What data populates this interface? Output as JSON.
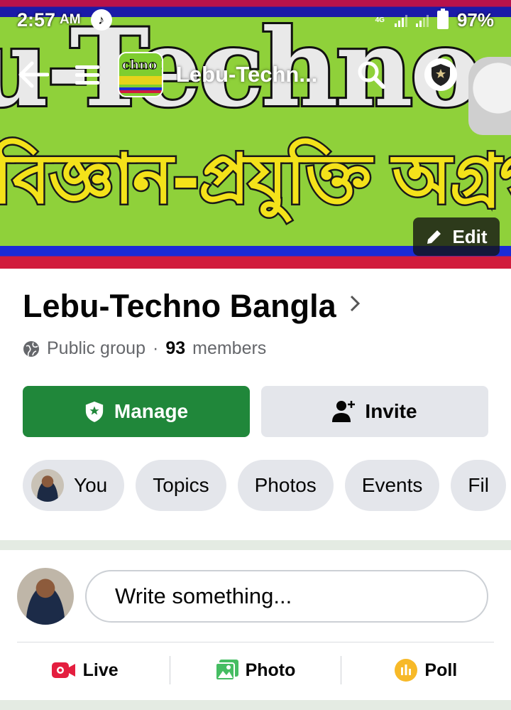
{
  "status_bar": {
    "time": "2:57",
    "ampm": "AM",
    "network": "4G",
    "battery": "97%"
  },
  "cover": {
    "headline": "u-Techno Bangla",
    "subline": "বিজ্ঞান-প্রযুক্তি অগ্রগতিতে এগি",
    "thumb_text": "chno Ban",
    "colors": {
      "banner_green": "#8fd13a",
      "text_yellow": "#f4e21a"
    }
  },
  "top_nav": {
    "title": "Lebu-Techn...",
    "icons": [
      "back-arrow-icon",
      "menu-icon",
      "search-icon",
      "admin-shield-icon"
    ]
  },
  "edit_button": {
    "label": "Edit"
  },
  "group": {
    "name": "Lebu-Techno Bangla",
    "privacy": "Public group",
    "separator": "·",
    "member_count": "93",
    "members_label": "members"
  },
  "buttons": {
    "manage": "Manage",
    "invite": "Invite",
    "manage_color": "#20873a"
  },
  "chips": [
    "You",
    "Topics",
    "Photos",
    "Events",
    "Fil"
  ],
  "composer": {
    "placeholder": "Write something..."
  },
  "post_actions": [
    {
      "label": "Live",
      "icon": "live-video-icon",
      "color": "#e41e3f"
    },
    {
      "label": "Photo",
      "icon": "photo-icon",
      "color": "#45bd62"
    },
    {
      "label": "Poll",
      "icon": "poll-icon",
      "color": "#f7b928"
    }
  ]
}
